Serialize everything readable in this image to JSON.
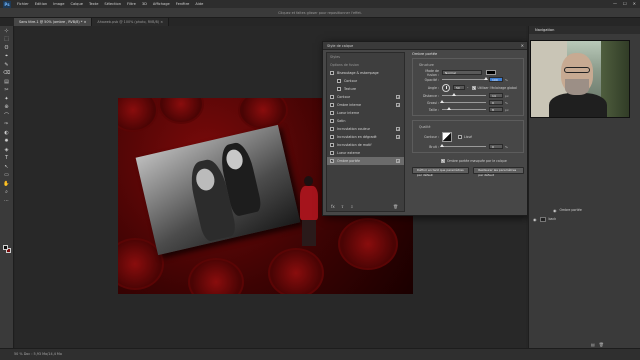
{
  "app": {
    "logo": "Ps",
    "menu": [
      "Fichier",
      "Edition",
      "Image",
      "Calque",
      "Texte",
      "Sélection",
      "Filtre",
      "3D",
      "Affichage",
      "Fenêtre",
      "Aide"
    ],
    "window_controls": [
      "—",
      "☐",
      "✕"
    ]
  },
  "options_bar": {
    "hint": "Cliquez et faites glisser pour repositionner l'effet."
  },
  "tabs": [
    {
      "label": "Sans titre-1 @ 50% (ombre , RVB/8) *",
      "close": "×"
    },
    {
      "label": "Ahaweb.psb @ 100% (photo, RVB/8)",
      "close": "×"
    }
  ],
  "tools": [
    "⊹",
    "⬚",
    "ʘ",
    "⌖",
    "✎",
    "⌫",
    "▤",
    "✂",
    "✦",
    "⊕",
    "⌒",
    "✑",
    "◐",
    "✹",
    "◈",
    "T",
    "↖",
    "▭",
    "✋",
    "⌕",
    "⋯"
  ],
  "colors": {
    "foreground": "#0d0d0d",
    "background": "#7a0b0b",
    "accent": "#3f7fd4"
  },
  "status_bar": {
    "text": "50 %   Doc : 5,93 Mo/14,4 Mo"
  },
  "dialog": {
    "title": "Style de calque",
    "close": "✕",
    "list": [
      {
        "label": "Styles",
        "kind": "head"
      },
      {
        "label": "Options de fusion",
        "kind": "head"
      },
      {
        "label": "Biseautage & estampage",
        "kind": "check",
        "checked": false
      },
      {
        "label": "Contour",
        "kind": "check",
        "checked": false,
        "indent": true
      },
      {
        "label": "Texture",
        "kind": "check",
        "checked": false,
        "indent": true
      },
      {
        "label": "Contour",
        "kind": "check",
        "checked": false,
        "plus": true
      },
      {
        "label": "Ombre interne",
        "kind": "check",
        "checked": false,
        "plus": true
      },
      {
        "label": "Lueur interne",
        "kind": "check",
        "checked": false
      },
      {
        "label": "Satin",
        "kind": "check",
        "checked": false
      },
      {
        "label": "Incrustation couleur",
        "kind": "check",
        "checked": false,
        "plus": true
      },
      {
        "label": "Incrustation en dégradé",
        "kind": "check",
        "checked": false,
        "plus": true
      },
      {
        "label": "Incrustation de motif",
        "kind": "check",
        "checked": false
      },
      {
        "label": "Lueur externe",
        "kind": "check",
        "checked": false
      },
      {
        "label": "Ombre portée",
        "kind": "check",
        "checked": true,
        "plus": true,
        "selected": true
      }
    ],
    "list_footer": [
      "fx",
      "⇧",
      "⇩",
      "🗑"
    ],
    "settings": {
      "section_title": "Ombre portée",
      "structure_title": "Structure",
      "blend_mode_label": "Mode de fusion :",
      "blend_mode_value": "Normal",
      "opacity_label": "Opacité :",
      "opacity_value": "100",
      "opacity_level": 1.0,
      "angle_label": "Angle :",
      "angle_value": "50",
      "global_light_label": "Utiliser l'éclairage global",
      "distance_label": "Distance :",
      "distance_value": "14",
      "distance_level": 0.28,
      "spread_label": "Grossi :",
      "spread_value": "0",
      "spread_level": 0.0,
      "size_label": "Taille :",
      "size_value": "8",
      "size_level": 0.15,
      "unit_percent": "%",
      "unit_px": "px",
      "unit_degree": "°",
      "quality_title": "Qualité",
      "contour_label": "Contour :",
      "antialias_label": "Lissé",
      "noise_label": "Bruit :",
      "noise_value": "0",
      "noise_level": 0.0,
      "knockout_label": "Ombre portée masquée par le calque",
      "default_set_button": "Définir en tant que paramètres par défaut",
      "default_reset_button": "Restaurer les paramètres par défaut"
    }
  },
  "panels": {
    "navigator_title": "Navigation",
    "layers": [
      {
        "label": "Ombre portée",
        "sub": true
      },
      {
        "label": "back",
        "sub": false
      }
    ],
    "layers_footer": [
      "▤",
      "🗑"
    ]
  }
}
